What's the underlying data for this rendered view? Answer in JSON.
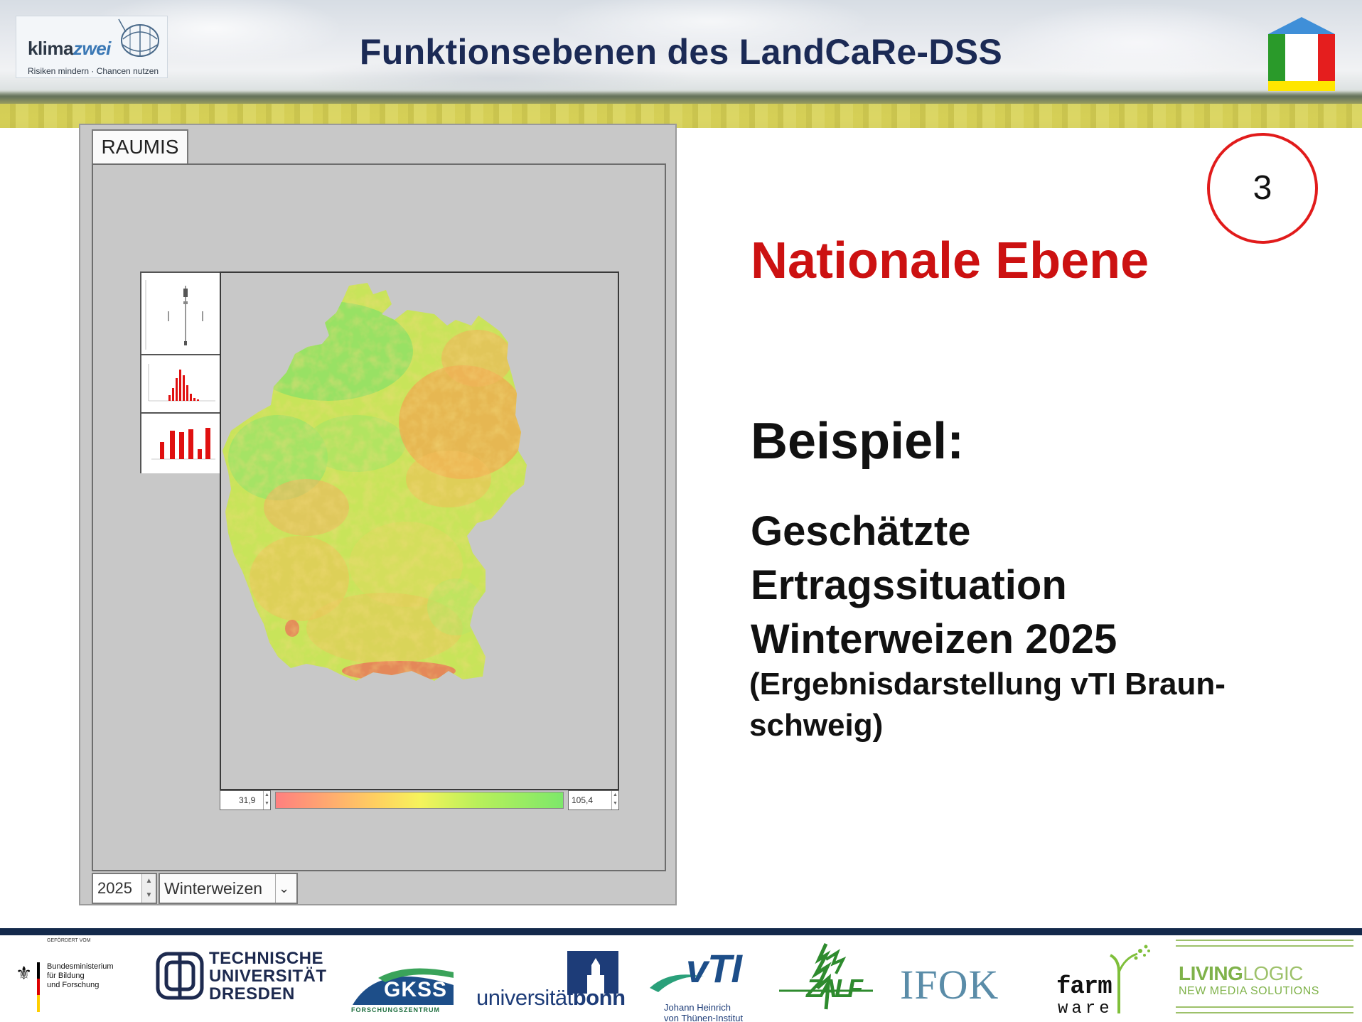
{
  "header": {
    "title": "Funktionsebenen des LandCaRe-DSS",
    "logo_brand": "klima",
    "logo_brand_accent": "zwei",
    "logo_tagline": "Risiken mindern · Chancen nutzen"
  },
  "app": {
    "tab_label": "RAUMIS",
    "legend_min": "31,9",
    "legend_max": "105,4",
    "year_value": "2025",
    "crop_value": "Winterweizen",
    "colors": {
      "low": "#ff7f7f",
      "mid": "#f6f35b",
      "high": "#7de86a"
    }
  },
  "content": {
    "level_number": "3",
    "level_title": "Nationale Ebene",
    "example_label": "Beispiel:",
    "example_desc_lines": [
      "Geschätzte",
      "Ertragssituation",
      "Winterweizen 2025"
    ],
    "example_source_lines": [
      "(Ergebnisdarstellung vTI Braun-",
      "schweig)"
    ]
  },
  "footer": {
    "bmbf_funded": "GEFÖRDERT VOM",
    "bmbf_name_lines": [
      "Bundesministerium",
      "für Bildung",
      "und Forschung"
    ],
    "tud_lines": [
      "TECHNISCHE",
      "UNIVERSITÄT",
      "DRESDEN"
    ],
    "gkss_name": "GKSS",
    "gkss_sub": "FORSCHUNGSZENTRUM",
    "bonn_a": "universität",
    "bonn_b": "bonn",
    "vti_name": "vTI",
    "vti_sub_lines": [
      "Johann Heinrich",
      "von Thünen-Institut"
    ],
    "zalf_name": "ZALF",
    "ifok_name": "IFOK",
    "farm_a": "farm",
    "farm_b": "ware",
    "living_a": "LIVING",
    "living_b": "LOGIC",
    "living_sub": "NEW MEDIA SOLUTIONS"
  }
}
